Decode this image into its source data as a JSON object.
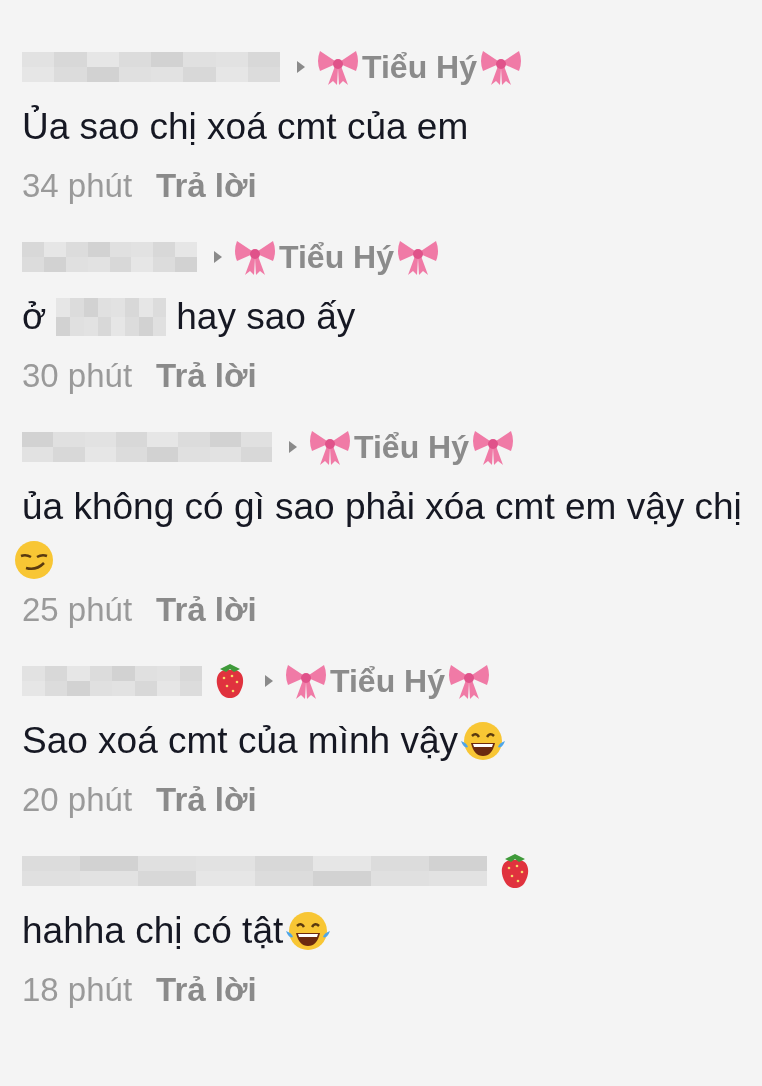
{
  "comments": [
    {
      "has_author_icon": false,
      "reply_to": "Tiểu Hý",
      "text_parts": [
        {
          "kind": "text",
          "text": "Ủa sao chị xoá cmt của em"
        }
      ],
      "time": "34 phút",
      "reply": "Trả lời"
    },
    {
      "has_author_icon": false,
      "reply_to": "Tiểu Hý",
      "text_parts": [
        {
          "kind": "text",
          "text": "ở"
        },
        {
          "kind": "blur"
        },
        {
          "kind": "text",
          "text": "hay sao ấy"
        }
      ],
      "time": "30 phút",
      "reply": "Trả lời"
    },
    {
      "has_author_icon": false,
      "reply_to": "Tiểu Hý",
      "text_parts": [
        {
          "kind": "text",
          "text": "ủa không có gì sao phải xóa cmt em vậy chị"
        },
        {
          "kind": "smirk"
        }
      ],
      "time": "25 phút",
      "reply": "Trả lời"
    },
    {
      "has_author_icon": true,
      "reply_to": "Tiểu Hý",
      "text_parts": [
        {
          "kind": "text",
          "text": "Sao xoá cmt của mình vậy"
        },
        {
          "kind": "laugh"
        }
      ],
      "time": "20 phút",
      "reply": "Trả lời"
    },
    {
      "has_author_icon": true,
      "text_parts": [
        {
          "kind": "text",
          "text": "hahha chị có tật"
        },
        {
          "kind": "laugh"
        }
      ],
      "time": "18 phút",
      "reply": "Trả lời"
    }
  ]
}
